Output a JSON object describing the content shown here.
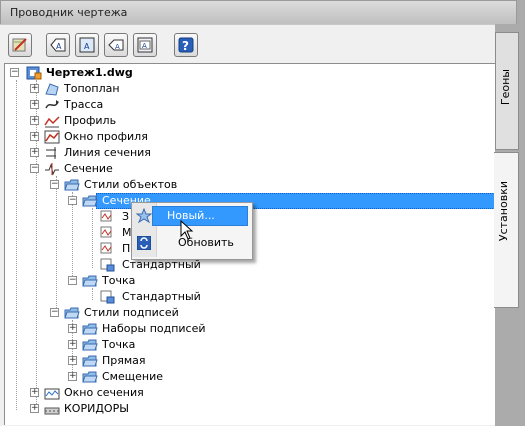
{
  "title": "Проводник чертежа",
  "toolbar": {
    "buttons": [
      {
        "name": "drawing-settings-button",
        "icon": "pencil-edit-icon"
      },
      {
        "name": "style-button-1",
        "icon": "style-tag-icon"
      },
      {
        "name": "style-button-2",
        "icon": "style-tag-icon"
      },
      {
        "name": "style-button-3",
        "icon": "style-tag-icon"
      },
      {
        "name": "style-button-4",
        "icon": "style-tag-icon"
      },
      {
        "name": "help-button",
        "icon": "help-icon",
        "label": "?"
      }
    ]
  },
  "tree": {
    "root": "Чертеж1.dwg",
    "items": {
      "topoplan": "Топоплан",
      "trassa": "Трасса",
      "profil": "Профиль",
      "okno_profilya": "Окно профиля",
      "liniya_secheniya": "Линия сечения",
      "sechenie": "Сечение",
      "stili_obektov": "Стили объектов",
      "sechenie_child": "Сечение",
      "child_1": "З",
      "child_2": "М",
      "child_3": "П",
      "standartny_1": "Стандартный",
      "tochka": "Точка",
      "standartny_2": "Стандартный",
      "stili_podpisey": "Стили подписей",
      "nabory_podpisey": "Наборы подписей",
      "tochka_2": "Точка",
      "pryamaya": "Прямая",
      "smeshchenie": "Смещение",
      "okno_secheniya": "Окно сечения",
      "koridory": "КОРИДОРЫ"
    }
  },
  "tabs": {
    "geony": "Геоны",
    "ustanovki": "Установки"
  },
  "context_menu": {
    "new": "Новый...",
    "refresh": "Обновить"
  },
  "colors": {
    "selection": "#3399ff",
    "background": "#ababab",
    "panel": "#f0f0f0"
  }
}
